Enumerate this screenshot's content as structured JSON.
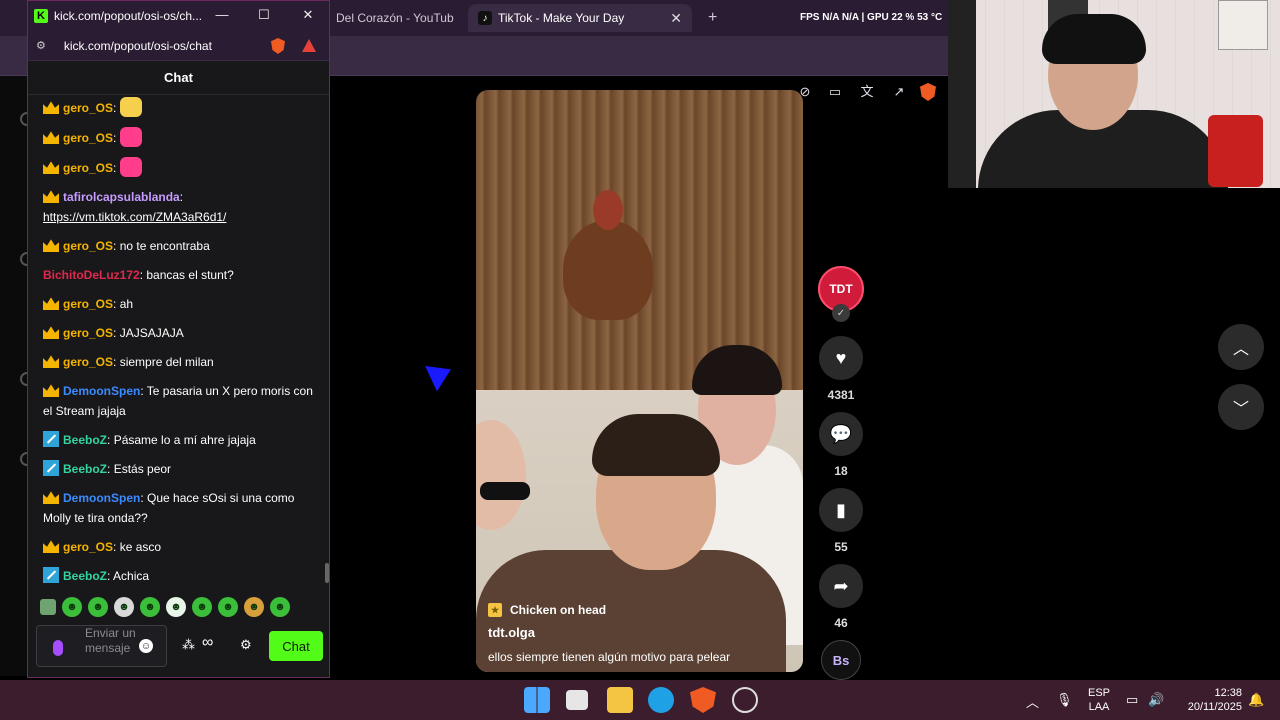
{
  "background_browser": {
    "tab_prev_title": "Del Corazón - YouTub",
    "tab_active_title": "TikTok - Make Your Day",
    "tab_close": "✕",
    "new_tab": "+",
    "stats": "FPS N/A N/A  |  GPU 22 % 53 °C"
  },
  "video": {
    "badge_label": "Chicken on head",
    "username": "tdt.olga",
    "caption": "ellos siempre tienen algún motivo para pelear",
    "creator_avatar_text": "TDT",
    "likes": "4381",
    "comments": "18",
    "saves": "55",
    "shares": "46",
    "music_disc_text": "Bs"
  },
  "chat_window": {
    "window_title": "kick.com/popout/osi-os/ch...",
    "url": "kick.com/popout/osi-os/chat",
    "header": "Chat",
    "placeholder": "Enviar un mensaje",
    "send_label": "Chat",
    "infinity": "∞",
    "gear": "⚙",
    "messages": [
      {
        "user": "gero_OS",
        "color": "#f4b400",
        "badge": "crown",
        "text": "",
        "emote": "#f6d04d"
      },
      {
        "user": "gero_OS",
        "color": "#f4b400",
        "badge": "crown",
        "text": "",
        "emote": "#ff3d8b"
      },
      {
        "user": "gero_OS",
        "color": "#f4b400",
        "badge": "crown",
        "text": "",
        "emote": "#ff3d8b"
      },
      {
        "user": "tafirolcapsulablanda",
        "color": "#c79cff",
        "badge": "crown",
        "text": "",
        "link": "https://vm.tiktok.com/ZMA3aR6d1/"
      },
      {
        "user": "gero_OS",
        "color": "#f4b400",
        "badge": "crown",
        "text": "no te encontraba"
      },
      {
        "user": "BichitoDeLuz172",
        "color": "#e0284d",
        "badge": "",
        "text": "bancas el stunt?"
      },
      {
        "user": "gero_OS",
        "color": "#f4b400",
        "badge": "crown",
        "text": "ah"
      },
      {
        "user": "gero_OS",
        "color": "#f4b400",
        "badge": "crown",
        "text": "JAJSAJAJA"
      },
      {
        "user": "gero_OS",
        "color": "#f4b400",
        "badge": "crown",
        "text": "siempre del milan"
      },
      {
        "user": "DemoonSpen",
        "color": "#3a8bff",
        "badge": "crown",
        "text": "Te pasaria un X pero moris con el Stream jajaja"
      },
      {
        "user": "BeeboZ",
        "color": "#34d4a0",
        "badge": "sword",
        "text": "Pásame lo a mí ahre jajaja"
      },
      {
        "user": "BeeboZ",
        "color": "#34d4a0",
        "badge": "sword",
        "text": "Estás peor"
      },
      {
        "user": "DemoonSpen",
        "color": "#3a8bff",
        "badge": "crown",
        "text": "Que hace sOsi si una como Molly te tira onda??"
      },
      {
        "user": "gero_OS",
        "color": "#f4b400",
        "badge": "crown",
        "text": "ke asco"
      },
      {
        "user": "BeeboZ",
        "color": "#34d4a0",
        "badge": "sword",
        "text": "Achica"
      }
    ]
  },
  "taskbar": {
    "language": "ESP",
    "layout": "LAA",
    "time": "12:38",
    "date": "20/11/2025"
  }
}
